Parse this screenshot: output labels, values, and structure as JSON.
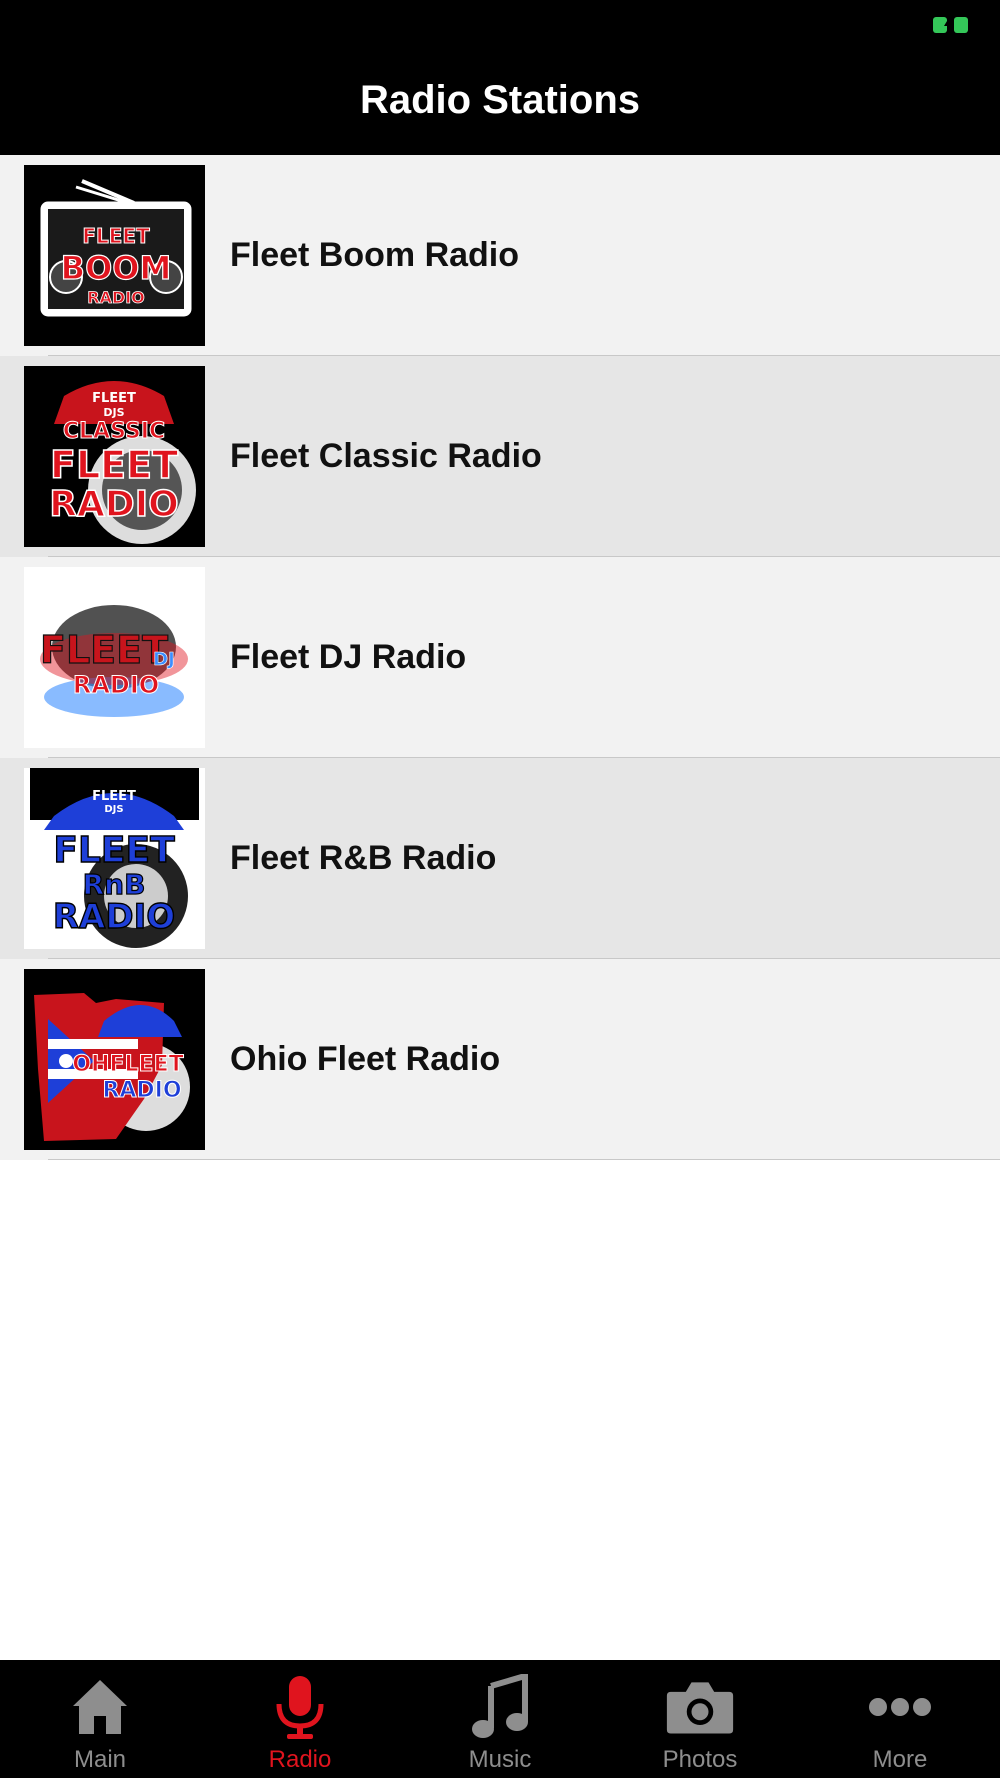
{
  "header": {
    "title": "Radio Stations",
    "battery_color": "#34c759"
  },
  "stations": [
    {
      "name": "Fleet Boom Radio",
      "logo_text": [
        "FLEET",
        "BOOM",
        "RADIO"
      ],
      "logo_icon": "boombox-logo"
    },
    {
      "name": "Fleet Classic Radio",
      "logo_text": [
        "FLEET",
        "DJS",
        "CLASSIC",
        "FLEET",
        "RADIO"
      ],
      "logo_icon": "classic-logo"
    },
    {
      "name": "Fleet DJ Radio",
      "logo_text": [
        "FLEET",
        "DJ",
        "RADIO"
      ],
      "logo_icon": "dj-logo"
    },
    {
      "name": "Fleet R&B Radio",
      "logo_text": [
        "FLEET",
        "DJS",
        "FLEET",
        "RnB",
        "RADIO"
      ],
      "logo_icon": "rnb-logo"
    },
    {
      "name": "Ohio Fleet Radio",
      "logo_text": [
        "OHFLEET",
        "RADIO"
      ],
      "logo_icon": "ohio-logo"
    }
  ],
  "tabbar": {
    "active_color": "#e0141e",
    "inactive_color": "#8e8e8e",
    "tabs": [
      {
        "label": "Main",
        "icon": "home-icon"
      },
      {
        "label": "Radio",
        "icon": "microphone-icon",
        "active": true
      },
      {
        "label": "Music",
        "icon": "music-note-icon"
      },
      {
        "label": "Photos",
        "icon": "camera-icon"
      },
      {
        "label": "More",
        "icon": "more-dots-icon"
      }
    ]
  }
}
